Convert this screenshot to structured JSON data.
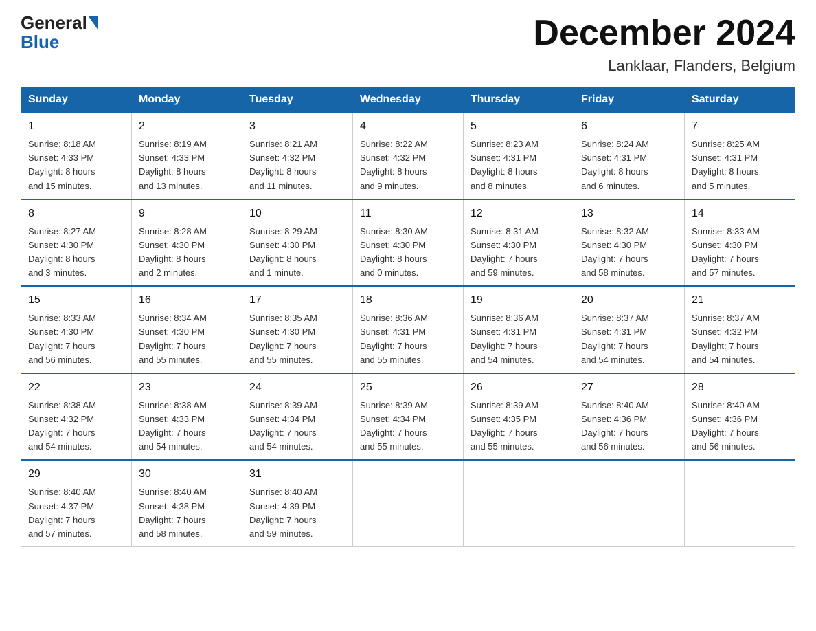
{
  "header": {
    "logo_general": "General",
    "logo_blue": "Blue",
    "month_title": "December 2024",
    "location": "Lanklaar, Flanders, Belgium"
  },
  "weekdays": [
    "Sunday",
    "Monday",
    "Tuesday",
    "Wednesday",
    "Thursday",
    "Friday",
    "Saturday"
  ],
  "weeks": [
    [
      {
        "day": "1",
        "info": "Sunrise: 8:18 AM\nSunset: 4:33 PM\nDaylight: 8 hours\nand 15 minutes."
      },
      {
        "day": "2",
        "info": "Sunrise: 8:19 AM\nSunset: 4:33 PM\nDaylight: 8 hours\nand 13 minutes."
      },
      {
        "day": "3",
        "info": "Sunrise: 8:21 AM\nSunset: 4:32 PM\nDaylight: 8 hours\nand 11 minutes."
      },
      {
        "day": "4",
        "info": "Sunrise: 8:22 AM\nSunset: 4:32 PM\nDaylight: 8 hours\nand 9 minutes."
      },
      {
        "day": "5",
        "info": "Sunrise: 8:23 AM\nSunset: 4:31 PM\nDaylight: 8 hours\nand 8 minutes."
      },
      {
        "day": "6",
        "info": "Sunrise: 8:24 AM\nSunset: 4:31 PM\nDaylight: 8 hours\nand 6 minutes."
      },
      {
        "day": "7",
        "info": "Sunrise: 8:25 AM\nSunset: 4:31 PM\nDaylight: 8 hours\nand 5 minutes."
      }
    ],
    [
      {
        "day": "8",
        "info": "Sunrise: 8:27 AM\nSunset: 4:30 PM\nDaylight: 8 hours\nand 3 minutes."
      },
      {
        "day": "9",
        "info": "Sunrise: 8:28 AM\nSunset: 4:30 PM\nDaylight: 8 hours\nand 2 minutes."
      },
      {
        "day": "10",
        "info": "Sunrise: 8:29 AM\nSunset: 4:30 PM\nDaylight: 8 hours\nand 1 minute."
      },
      {
        "day": "11",
        "info": "Sunrise: 8:30 AM\nSunset: 4:30 PM\nDaylight: 8 hours\nand 0 minutes."
      },
      {
        "day": "12",
        "info": "Sunrise: 8:31 AM\nSunset: 4:30 PM\nDaylight: 7 hours\nand 59 minutes."
      },
      {
        "day": "13",
        "info": "Sunrise: 8:32 AM\nSunset: 4:30 PM\nDaylight: 7 hours\nand 58 minutes."
      },
      {
        "day": "14",
        "info": "Sunrise: 8:33 AM\nSunset: 4:30 PM\nDaylight: 7 hours\nand 57 minutes."
      }
    ],
    [
      {
        "day": "15",
        "info": "Sunrise: 8:33 AM\nSunset: 4:30 PM\nDaylight: 7 hours\nand 56 minutes."
      },
      {
        "day": "16",
        "info": "Sunrise: 8:34 AM\nSunset: 4:30 PM\nDaylight: 7 hours\nand 55 minutes."
      },
      {
        "day": "17",
        "info": "Sunrise: 8:35 AM\nSunset: 4:30 PM\nDaylight: 7 hours\nand 55 minutes."
      },
      {
        "day": "18",
        "info": "Sunrise: 8:36 AM\nSunset: 4:31 PM\nDaylight: 7 hours\nand 55 minutes."
      },
      {
        "day": "19",
        "info": "Sunrise: 8:36 AM\nSunset: 4:31 PM\nDaylight: 7 hours\nand 54 minutes."
      },
      {
        "day": "20",
        "info": "Sunrise: 8:37 AM\nSunset: 4:31 PM\nDaylight: 7 hours\nand 54 minutes."
      },
      {
        "day": "21",
        "info": "Sunrise: 8:37 AM\nSunset: 4:32 PM\nDaylight: 7 hours\nand 54 minutes."
      }
    ],
    [
      {
        "day": "22",
        "info": "Sunrise: 8:38 AM\nSunset: 4:32 PM\nDaylight: 7 hours\nand 54 minutes."
      },
      {
        "day": "23",
        "info": "Sunrise: 8:38 AM\nSunset: 4:33 PM\nDaylight: 7 hours\nand 54 minutes."
      },
      {
        "day": "24",
        "info": "Sunrise: 8:39 AM\nSunset: 4:34 PM\nDaylight: 7 hours\nand 54 minutes."
      },
      {
        "day": "25",
        "info": "Sunrise: 8:39 AM\nSunset: 4:34 PM\nDaylight: 7 hours\nand 55 minutes."
      },
      {
        "day": "26",
        "info": "Sunrise: 8:39 AM\nSunset: 4:35 PM\nDaylight: 7 hours\nand 55 minutes."
      },
      {
        "day": "27",
        "info": "Sunrise: 8:40 AM\nSunset: 4:36 PM\nDaylight: 7 hours\nand 56 minutes."
      },
      {
        "day": "28",
        "info": "Sunrise: 8:40 AM\nSunset: 4:36 PM\nDaylight: 7 hours\nand 56 minutes."
      }
    ],
    [
      {
        "day": "29",
        "info": "Sunrise: 8:40 AM\nSunset: 4:37 PM\nDaylight: 7 hours\nand 57 minutes."
      },
      {
        "day": "30",
        "info": "Sunrise: 8:40 AM\nSunset: 4:38 PM\nDaylight: 7 hours\nand 58 minutes."
      },
      {
        "day": "31",
        "info": "Sunrise: 8:40 AM\nSunset: 4:39 PM\nDaylight: 7 hours\nand 59 minutes."
      },
      null,
      null,
      null,
      null
    ]
  ]
}
